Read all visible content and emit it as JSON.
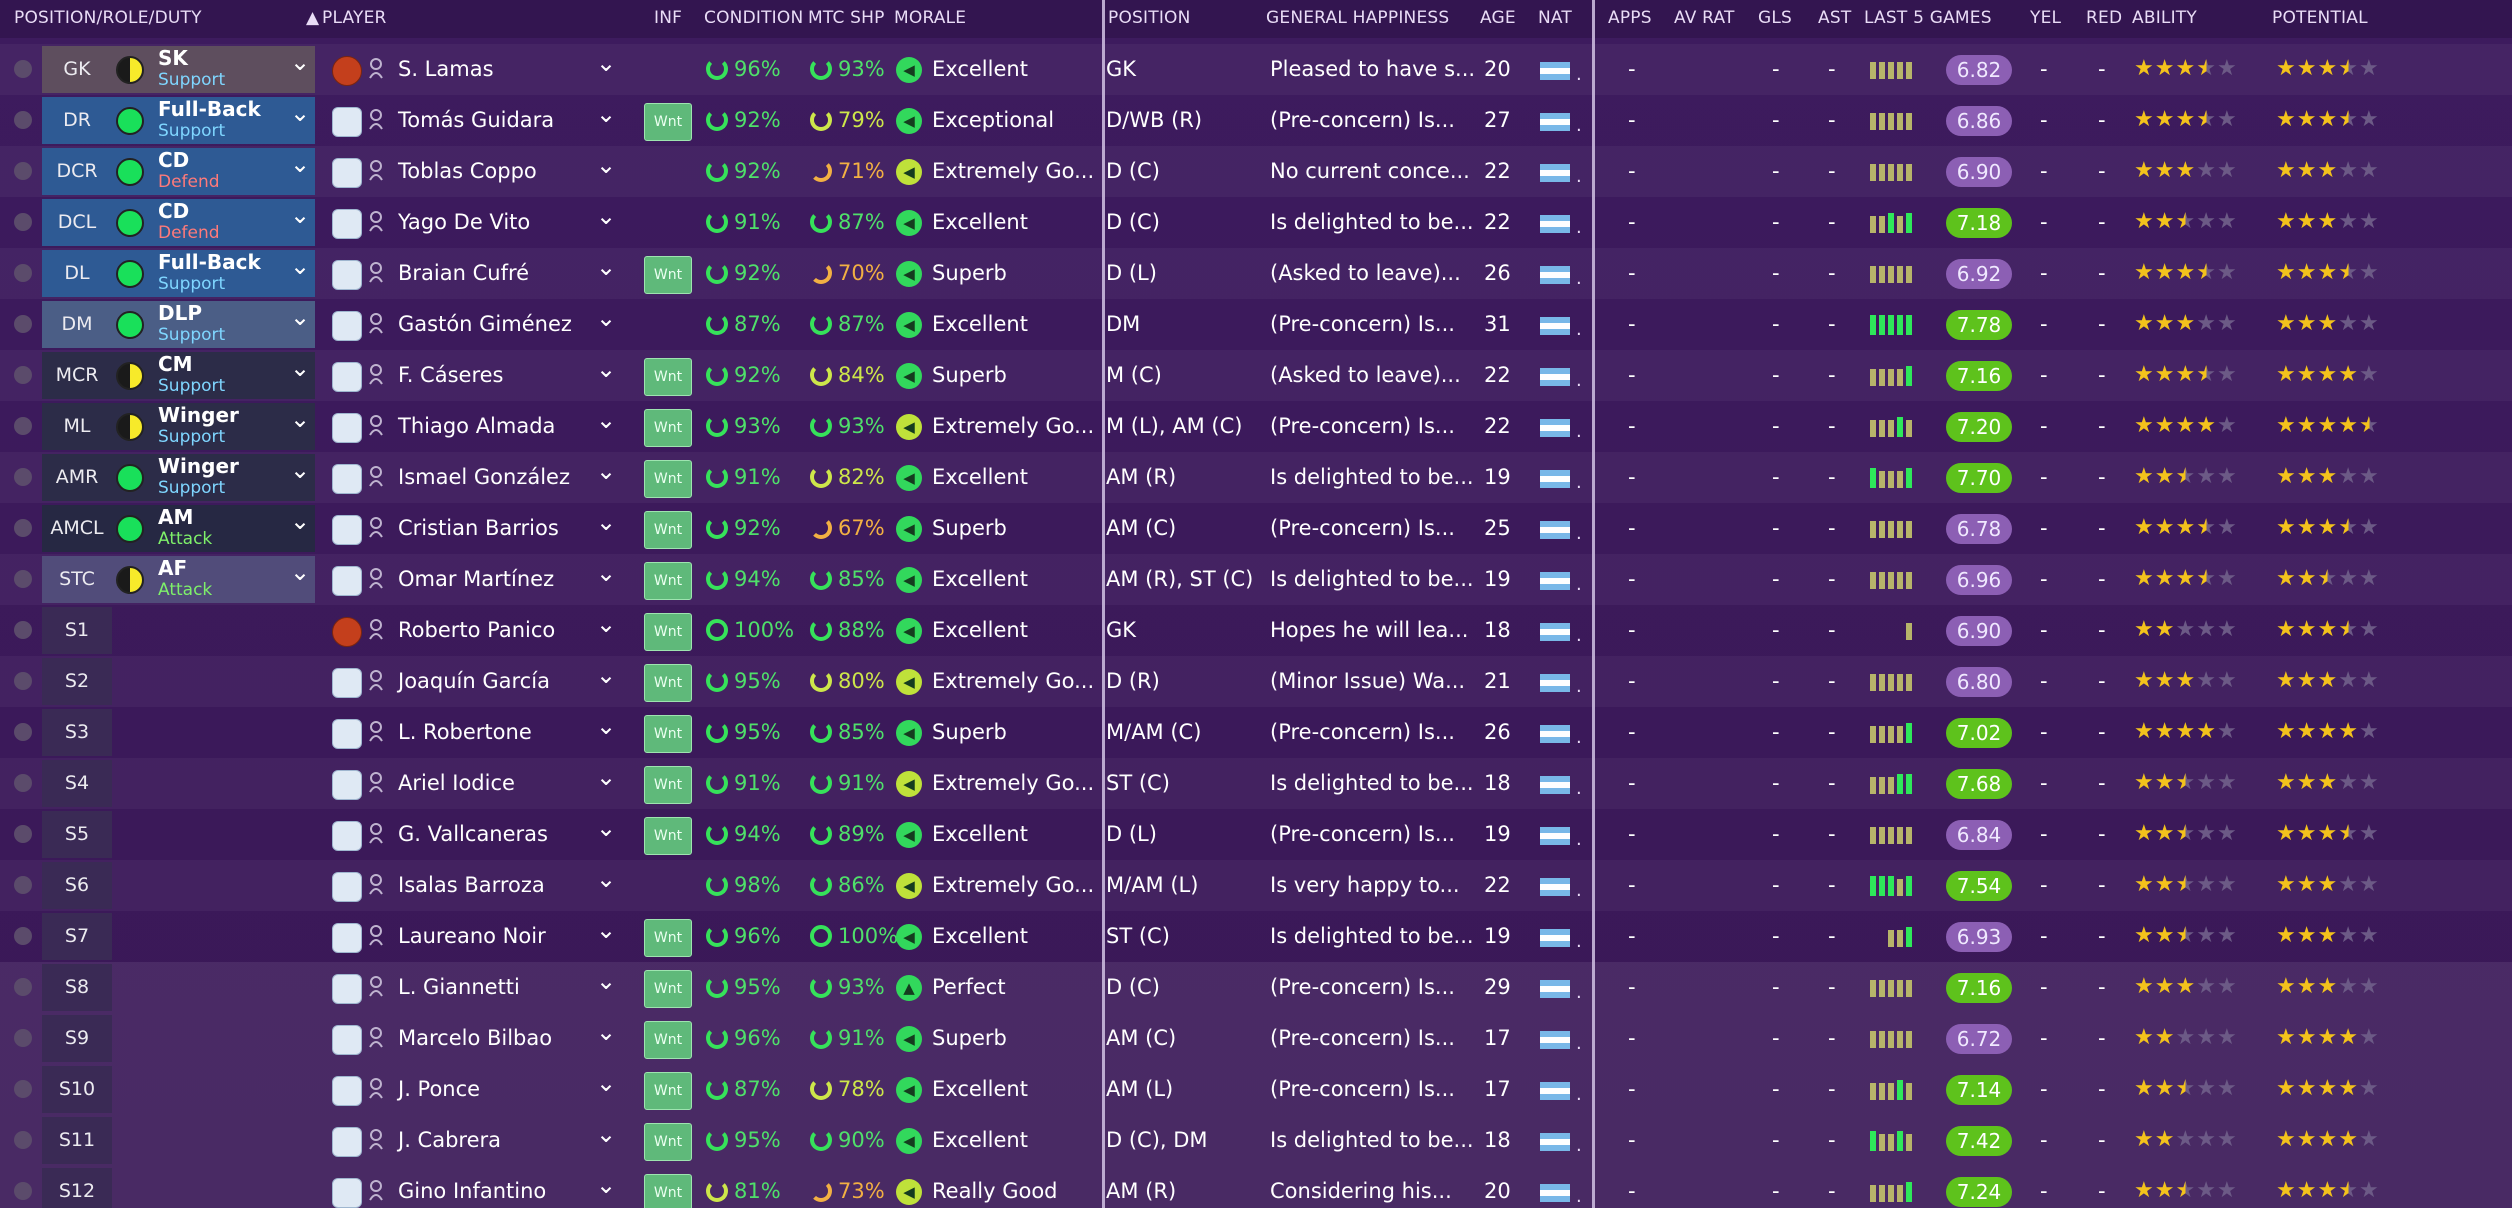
{
  "header": {
    "position_role_duty": "POSITION/ROLE/DUTY",
    "player": "PLAYER",
    "inf": "INF",
    "condition": "CONDITION",
    "mtc_shp": "MTC SHP",
    "morale": "MORALE",
    "position": "POSITION",
    "general_happiness": "GENERAL HAPPINESS",
    "age": "AGE",
    "nat": "NAT",
    "apps": "APPS",
    "av_rat": "AV RAT",
    "gls": "GLS",
    "ast": "AST",
    "last5": "LAST 5 GAMES",
    "yel": "YEL",
    "red": "RED",
    "ability": "ABILITY",
    "potential": "POTENTIAL"
  },
  "wnt_label": "Wnt",
  "dash": "-",
  "rows": [
    {
      "pos": "GK",
      "role": "SK",
      "duty": "Support",
      "dot": "half",
      "player": "S. Lamas",
      "gk": true,
      "inf": false,
      "cond": "96%",
      "shp": "93%",
      "morale": "Excellent",
      "position": "GK",
      "happy": "Pleased to have s...",
      "age": "20",
      "form": [
        0,
        0,
        0,
        0,
        0
      ],
      "rating": "6.82",
      "good": false,
      "ability": 3.5,
      "potential": 3.5
    },
    {
      "pos": "DR",
      "role": "Full-Back",
      "duty": "Support",
      "dot": "full",
      "player": "Tomás Guidara",
      "gk": false,
      "inf": true,
      "cond": "92%",
      "shp": "79%",
      "morale": "Exceptional",
      "position": "D/WB (R)",
      "happy": "(Pre-concern) Is...",
      "age": "27",
      "form": [
        0,
        0,
        0,
        0,
        0
      ],
      "rating": "6.86",
      "good": false,
      "ability": 3.5,
      "potential": 3.5
    },
    {
      "pos": "DCR",
      "role": "CD",
      "duty": "Defend",
      "dot": "full",
      "player": "Toblas Coppo",
      "gk": false,
      "inf": false,
      "cond": "92%",
      "shp": "71%",
      "morale": "Extremely Go...",
      "position": "D (C)",
      "happy": "No current conce...",
      "age": "22",
      "form": [
        0,
        0,
        0,
        0,
        0
      ],
      "rating": "6.90",
      "good": false,
      "ability": 3,
      "potential": 3
    },
    {
      "pos": "DCL",
      "role": "CD",
      "duty": "Defend",
      "dot": "full",
      "player": "Yago De Vito",
      "gk": false,
      "inf": false,
      "cond": "91%",
      "shp": "87%",
      "morale": "Excellent",
      "position": "D (C)",
      "happy": "Is delighted to be...",
      "age": "22",
      "form": [
        0,
        0,
        1,
        0,
        1
      ],
      "rating": "7.18",
      "good": true,
      "ability": 2.5,
      "potential": 3
    },
    {
      "pos": "DL",
      "role": "Full-Back",
      "duty": "Support",
      "dot": "full",
      "player": "Braian Cufré",
      "gk": false,
      "inf": true,
      "cond": "92%",
      "shp": "70%",
      "morale": "Superb",
      "position": "D (L)",
      "happy": "(Asked to leave)...",
      "age": "26",
      "form": [
        0,
        0,
        0,
        0,
        0
      ],
      "rating": "6.92",
      "good": false,
      "ability": 3.5,
      "potential": 3.5
    },
    {
      "pos": "DM",
      "role": "DLP",
      "duty": "Support",
      "dot": "full",
      "player": "Gastón Giménez",
      "gk": false,
      "inf": false,
      "cond": "87%",
      "shp": "87%",
      "morale": "Excellent",
      "position": "DM",
      "happy": "(Pre-concern) Is...",
      "age": "31",
      "form": [
        1,
        1,
        1,
        1,
        1
      ],
      "rating": "7.78",
      "good": true,
      "ability": 3,
      "potential": 3
    },
    {
      "pos": "MCR",
      "role": "CM",
      "duty": "Support",
      "dot": "half",
      "player": "F. Cáseres",
      "gk": false,
      "inf": true,
      "cond": "92%",
      "shp": "84%",
      "morale": "Superb",
      "position": "M (C)",
      "happy": "(Asked to leave)...",
      "age": "22",
      "form": [
        0,
        0,
        0,
        0,
        1
      ],
      "rating": "7.16",
      "good": true,
      "ability": 3.5,
      "potential": 4
    },
    {
      "pos": "ML",
      "role": "Winger",
      "duty": "Support",
      "dot": "half",
      "player": "Thiago Almada",
      "gk": false,
      "inf": true,
      "cond": "93%",
      "shp": "93%",
      "morale": "Extremely Go...",
      "position": "M (L), AM (C)",
      "happy": "(Pre-concern) Is...",
      "age": "22",
      "form": [
        0,
        0,
        0,
        1,
        0
      ],
      "rating": "7.20",
      "good": true,
      "ability": 4,
      "potential": 4.5
    },
    {
      "pos": "AMR",
      "role": "Winger",
      "duty": "Support",
      "dot": "full",
      "player": "Ismael González",
      "gk": false,
      "inf": true,
      "cond": "91%",
      "shp": "82%",
      "morale": "Excellent",
      "position": "AM (R)",
      "happy": "Is delighted to be...",
      "age": "19",
      "form": [
        1,
        0,
        0,
        0,
        1
      ],
      "rating": "7.70",
      "good": true,
      "ability": 2.5,
      "potential": 3
    },
    {
      "pos": "AMCL",
      "role": "AM",
      "duty": "Attack",
      "dot": "full",
      "player": "Cristian Barrios",
      "gk": false,
      "inf": true,
      "cond": "92%",
      "shp": "67%",
      "morale": "Superb",
      "position": "AM (C)",
      "happy": "(Pre-concern) Is...",
      "age": "25",
      "form": [
        0,
        0,
        0,
        0,
        0
      ],
      "rating": "6.78",
      "good": false,
      "ability": 3.5,
      "potential": 3.5
    },
    {
      "pos": "STC",
      "role": "AF",
      "duty": "Attack",
      "dot": "half",
      "player": "Omar Martínez",
      "gk": false,
      "inf": true,
      "cond": "94%",
      "shp": "85%",
      "morale": "Excellent",
      "position": "AM (R), ST (C)",
      "happy": "Is delighted to be...",
      "age": "19",
      "form": [
        0,
        0,
        0,
        0,
        0
      ],
      "rating": "6.96",
      "good": false,
      "ability": 3.5,
      "potential": 2.5
    },
    {
      "pos": "S1",
      "role": "",
      "duty": "",
      "dot": "",
      "player": "Roberto Panico",
      "gk": true,
      "inf": true,
      "cond": "100%",
      "shp": "88%",
      "morale": "Excellent",
      "position": "GK",
      "happy": "Hopes he will lea...",
      "age": "18",
      "form": [
        0
      ],
      "rating": "6.90",
      "good": false,
      "ability": 2,
      "potential": 3.5
    },
    {
      "pos": "S2",
      "role": "",
      "duty": "",
      "dot": "",
      "player": "Joaquín García",
      "gk": false,
      "inf": true,
      "cond": "95%",
      "shp": "80%",
      "morale": "Extremely Go...",
      "position": "D (R)",
      "happy": "(Minor Issue) Wa...",
      "age": "21",
      "form": [
        0,
        0,
        0,
        0,
        0
      ],
      "rating": "6.80",
      "good": false,
      "ability": 3,
      "potential": 3
    },
    {
      "pos": "S3",
      "role": "",
      "duty": "",
      "dot": "",
      "player": "L. Robertone",
      "gk": false,
      "inf": true,
      "cond": "95%",
      "shp": "85%",
      "morale": "Superb",
      "position": "M/AM (C)",
      "happy": "(Pre-concern) Is...",
      "age": "26",
      "form": [
        0,
        0,
        0,
        0,
        1
      ],
      "rating": "7.02",
      "good": true,
      "ability": 4,
      "potential": 4
    },
    {
      "pos": "S4",
      "role": "",
      "duty": "",
      "dot": "",
      "player": "Ariel Iodice",
      "gk": false,
      "inf": true,
      "cond": "91%",
      "shp": "91%",
      "morale": "Extremely Go...",
      "position": "ST (C)",
      "happy": "Is delighted to be...",
      "age": "18",
      "form": [
        0,
        0,
        0,
        1,
        1
      ],
      "rating": "7.68",
      "good": true,
      "ability": 2.5,
      "potential": 3
    },
    {
      "pos": "S5",
      "role": "",
      "duty": "",
      "dot": "",
      "player": "G. Vallcaneras",
      "gk": false,
      "inf": true,
      "cond": "94%",
      "shp": "89%",
      "morale": "Excellent",
      "position": "D (L)",
      "happy": "(Pre-concern) Is...",
      "age": "19",
      "form": [
        0,
        0,
        0,
        0,
        0
      ],
      "rating": "6.84",
      "good": false,
      "ability": 2.5,
      "potential": 3.5
    },
    {
      "pos": "S6",
      "role": "",
      "duty": "",
      "dot": "",
      "player": "Isalas Barroza",
      "gk": false,
      "inf": false,
      "cond": "98%",
      "shp": "86%",
      "morale": "Extremely Go...",
      "position": "M/AM (L)",
      "happy": "Is very happy to...",
      "age": "22",
      "form": [
        1,
        1,
        1,
        0,
        1
      ],
      "rating": "7.54",
      "good": true,
      "ability": 2.5,
      "potential": 3
    },
    {
      "pos": "S7",
      "role": "",
      "duty": "",
      "dot": "",
      "player": "Laureano Noir",
      "gk": false,
      "inf": true,
      "cond": "96%",
      "shp": "100%",
      "morale": "Excellent",
      "position": "ST (C)",
      "happy": "Is delighted to be...",
      "age": "19",
      "form": [
        0,
        0,
        1
      ],
      "rating": "6.93",
      "good": false,
      "ability": 2.5,
      "potential": 3
    },
    {
      "pos": "S8",
      "role": "",
      "duty": "",
      "dot": "",
      "player": "L. Giannetti",
      "gk": false,
      "inf": true,
      "cond": "95%",
      "shp": "93%",
      "morale": "Perfect",
      "position": "D (C)",
      "happy": "(Pre-concern) Is...",
      "age": "29",
      "form": [
        0,
        0,
        0,
        0,
        0
      ],
      "rating": "7.16",
      "good": true,
      "ability": 3,
      "potential": 3
    },
    {
      "pos": "S9",
      "role": "",
      "duty": "",
      "dot": "",
      "player": "Marcelo Bilbao",
      "gk": false,
      "inf": true,
      "cond": "96%",
      "shp": "91%",
      "morale": "Superb",
      "position": "AM (C)",
      "happy": "(Pre-concern) Is...",
      "age": "17",
      "form": [
        0,
        0,
        0,
        0,
        0
      ],
      "rating": "6.72",
      "good": false,
      "ability": 2,
      "potential": 4
    },
    {
      "pos": "S10",
      "role": "",
      "duty": "",
      "dot": "",
      "player": "J. Ponce",
      "gk": false,
      "inf": true,
      "cond": "87%",
      "shp": "78%",
      "morale": "Excellent",
      "position": "AM (L)",
      "happy": "(Pre-concern) Is...",
      "age": "17",
      "form": [
        0,
        0,
        0,
        1,
        0
      ],
      "rating": "7.14",
      "good": true,
      "ability": 2.5,
      "potential": 4
    },
    {
      "pos": "S11",
      "role": "",
      "duty": "",
      "dot": "",
      "player": "J. Cabrera",
      "gk": false,
      "inf": true,
      "cond": "95%",
      "shp": "90%",
      "morale": "Excellent",
      "position": "D (C), DM",
      "happy": "Is delighted to be...",
      "age": "18",
      "form": [
        1,
        0,
        0,
        1,
        0
      ],
      "rating": "7.42",
      "good": true,
      "ability": 2,
      "potential": 4
    },
    {
      "pos": "S12",
      "role": "",
      "duty": "",
      "dot": "",
      "player": "Gino Infantino",
      "gk": false,
      "inf": true,
      "cond": "81%",
      "shp": "73%",
      "morale": "Really Good",
      "position": "AM (R)",
      "happy": "Considering his...",
      "age": "20",
      "form": [
        0,
        0,
        0,
        0,
        1
      ],
      "rating": "7.24",
      "good": true,
      "ability": 2.5,
      "potential": 3.5
    }
  ]
}
